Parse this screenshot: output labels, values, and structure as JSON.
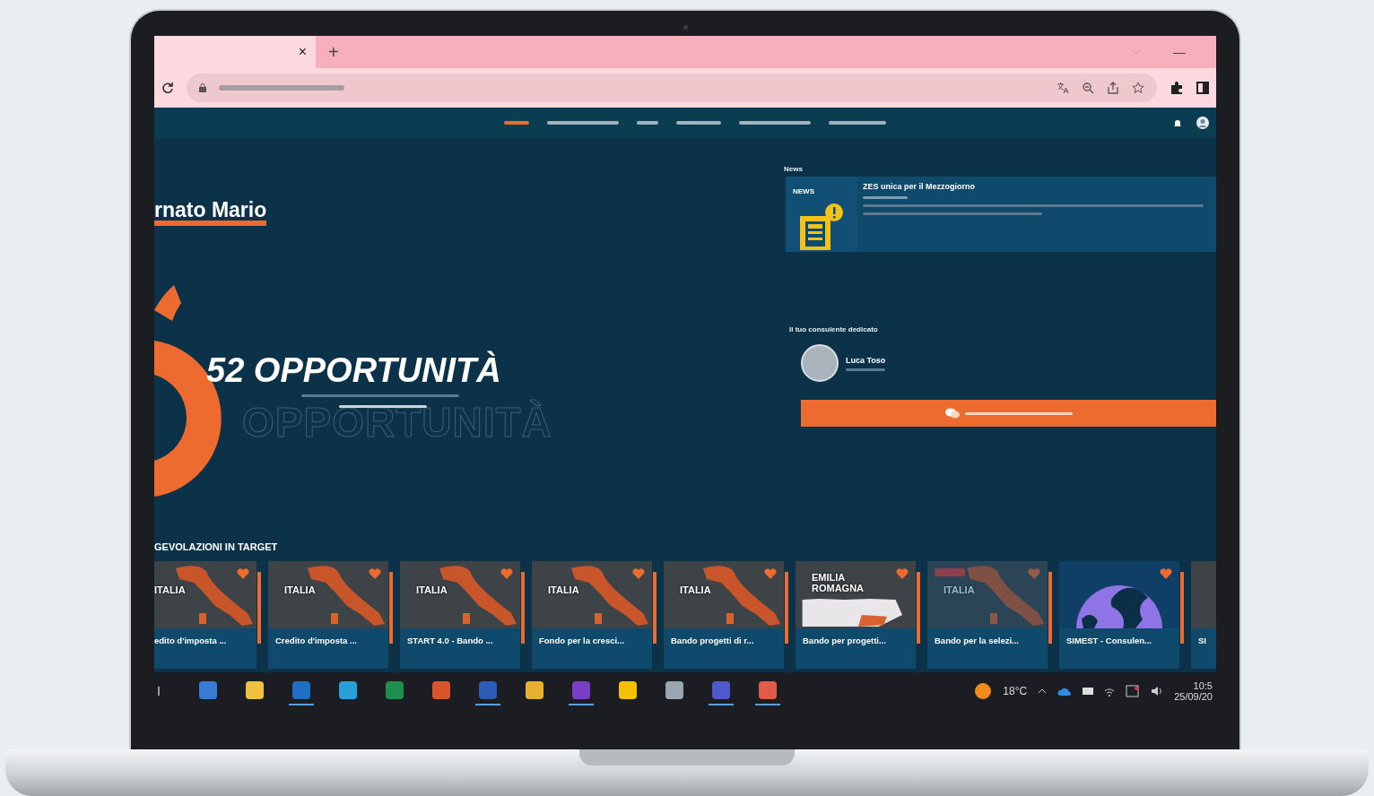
{
  "browser": {
    "tab": {
      "close": "×"
    },
    "new_tab": "+",
    "minimize": "—"
  },
  "nav": {
    "items": [
      {
        "selected": true
      },
      {
        "selected": false
      },
      {
        "selected": false
      },
      {
        "selected": false
      },
      {
        "selected": false
      },
      {
        "selected": false
      }
    ]
  },
  "hero": {
    "greeting": "rnato Mario",
    "headline": "52 OPPORTUNITÀ",
    "ghost_headline": "OPPORTUNITÀ"
  },
  "news": {
    "label": "News",
    "card": {
      "badge": "NEWS",
      "title": "ZES unica per il Mezzogiorno"
    }
  },
  "consultant": {
    "heading": "Il tuo consulente dedicato",
    "name": "Luca Toso"
  },
  "target": {
    "heading": "GEVOLAZIONI IN TARGET",
    "cards": [
      {
        "kind": "italy",
        "region": "ITALIA",
        "title": "edito d'imposta ...",
        "expired": false
      },
      {
        "kind": "italy",
        "region": "ITALIA",
        "title": "Credito d'imposta ...",
        "expired": false
      },
      {
        "kind": "italy",
        "region": "ITALIA",
        "title": "START 4.0 - Bando ...",
        "expired": false
      },
      {
        "kind": "italy",
        "region": "ITALIA",
        "title": "Fondo per la cresci...",
        "expired": false
      },
      {
        "kind": "italy",
        "region": "ITALIA",
        "title": "Bando progetti di r...",
        "expired": false
      },
      {
        "kind": "region",
        "region": "EMILIA ROMAGNA",
        "title": "Bando per progetti...",
        "expired": false
      },
      {
        "kind": "italy",
        "region": "ITALIA",
        "title": "Bando per la selezi...",
        "expired": true
      },
      {
        "kind": "globe",
        "title": "SIMEST - Consulen...",
        "expired": false
      },
      {
        "kind": "italy",
        "title": "SI",
        "expired": false
      }
    ]
  },
  "taskbar": {
    "apps": [
      {
        "running": false
      },
      {
        "running": false
      },
      {
        "running": true
      },
      {
        "running": false
      },
      {
        "running": false
      },
      {
        "running": false
      },
      {
        "running": true
      },
      {
        "running": false
      },
      {
        "running": true
      },
      {
        "running": false
      },
      {
        "running": false
      },
      {
        "running": true
      },
      {
        "running": true
      }
    ],
    "temperature": "18°C",
    "time": "10:5",
    "date": "25/09/20"
  }
}
